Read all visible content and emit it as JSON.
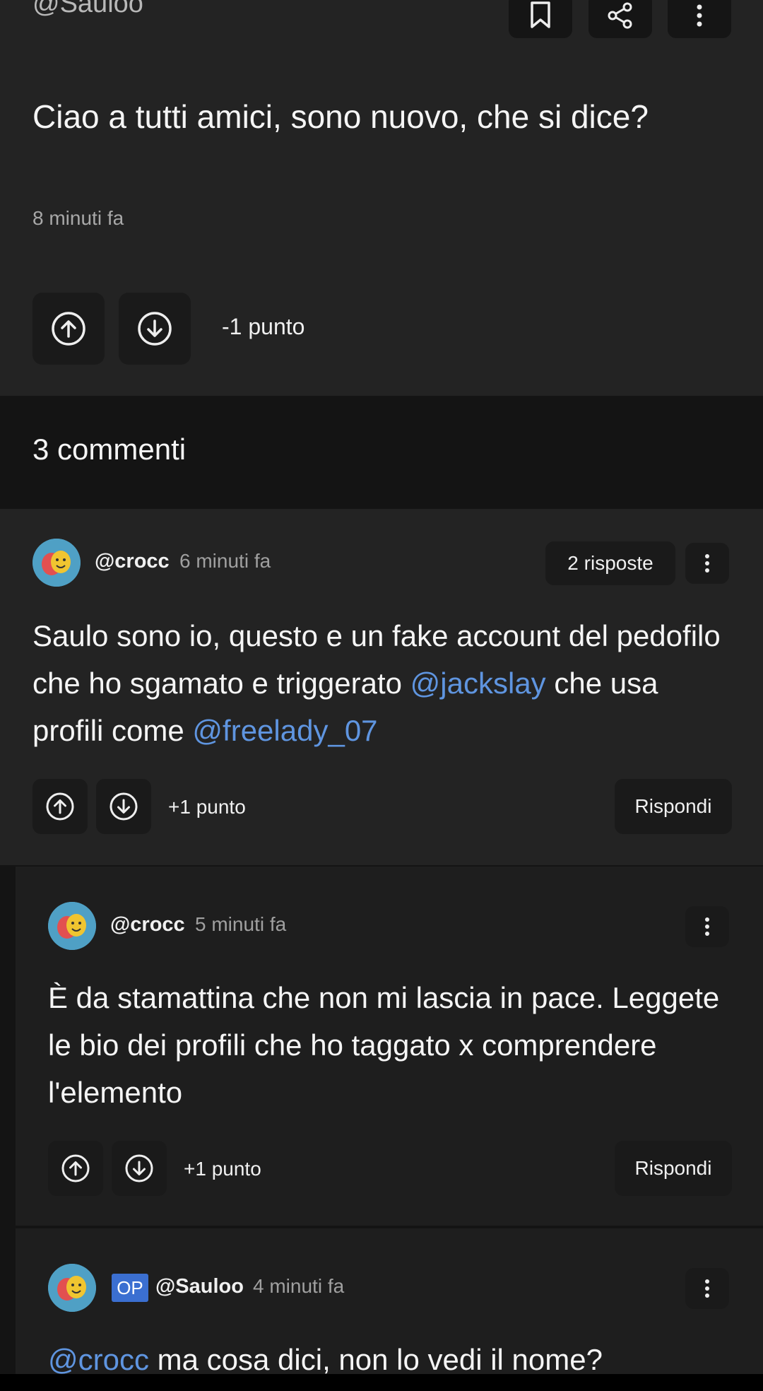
{
  "post": {
    "author": "@Sauloo",
    "text": "Ciao a tutti amici, sono nuovo, che si dice?",
    "time": "8 minuti fa",
    "score": "-1 punto"
  },
  "comments_header": "3 commenti",
  "comments": [
    {
      "user": "@crocc",
      "time": "6 minuti fa",
      "replies": "2 risposte",
      "text_parts": [
        "Saulo sono io, questo e un fake account del pedofilo che ho sgamato e triggerato ",
        "@jackslay",
        " che usa profili come ",
        "@freelady_07"
      ],
      "score": "+1 punto",
      "reply_label": "Rispondi"
    },
    {
      "user": "@crocc",
      "time": "5 minuti fa",
      "text": "È da stamattina che non mi lascia in pace. Leggete le bio dei profili che ho taggato x comprendere l'elemento",
      "score": "+1 punto",
      "reply_label": "Rispondi"
    },
    {
      "badge": "OP",
      "user": "@Sauloo",
      "time": "4 minuti fa",
      "text_parts": [
        "@crocc",
        " ma cosa dici, non lo vedi il nome?"
      ]
    }
  ],
  "colors": {
    "mention": "#5f95e0",
    "op_badge": "#3b6fd1",
    "background": "#141414",
    "card": "#232323"
  }
}
